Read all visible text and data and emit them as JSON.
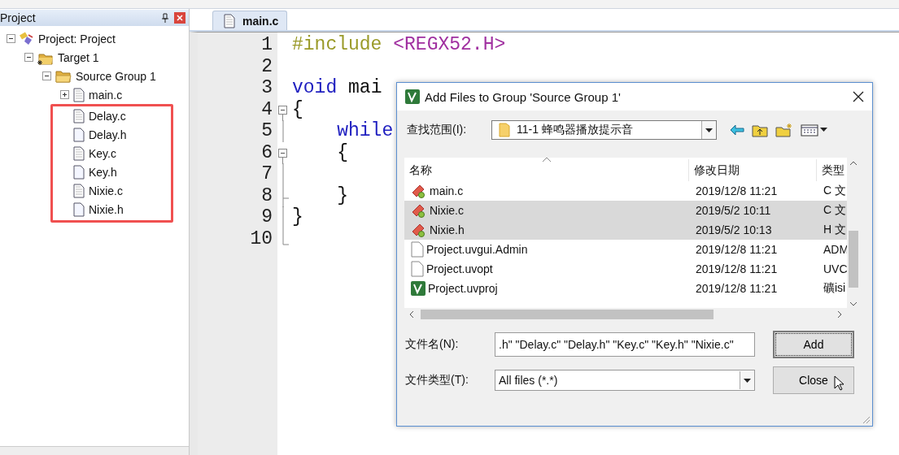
{
  "project_panel": {
    "title": "Project",
    "tree": [
      {
        "label": "Project: Project",
        "kind": "project",
        "expanded": true,
        "children": [
          {
            "label": "Target 1",
            "kind": "target",
            "expanded": true,
            "children": [
              {
                "label": "Source Group 1",
                "kind": "group",
                "expanded": true,
                "children": [
                  {
                    "label": "main.c",
                    "kind": "source",
                    "expanded": false,
                    "highlighted": false
                  },
                  {
                    "label": "Delay.c",
                    "kind": "source",
                    "highlighted": true
                  },
                  {
                    "label": "Delay.h",
                    "kind": "header",
                    "highlighted": true
                  },
                  {
                    "label": "Key.c",
                    "kind": "source",
                    "highlighted": true
                  },
                  {
                    "label": "Key.h",
                    "kind": "header",
                    "highlighted": true
                  },
                  {
                    "label": "Nixie.c",
                    "kind": "source",
                    "highlighted": true
                  },
                  {
                    "label": "Nixie.h",
                    "kind": "header",
                    "highlighted": true
                  }
                ]
              }
            ]
          }
        ]
      }
    ]
  },
  "editor": {
    "tabs": [
      {
        "label": "main.c",
        "selected": true
      }
    ],
    "lines": [
      {
        "number": "1",
        "kind": "plain",
        "segments": [
          {
            "text": "#include",
            "kind": "directive"
          },
          {
            "text": " <REGX52.H>",
            "kind": "header"
          }
        ]
      },
      {
        "number": "2",
        "kind": "plain"
      },
      {
        "number": "3",
        "kind": "plain",
        "segments": [
          {
            "text": "void",
            "kind": "keyword"
          },
          {
            "text": " mai",
            "kind": "plain"
          }
        ]
      },
      {
        "number": "4",
        "kind": "foldstart",
        "segments": [
          {
            "text": "{",
            "kind": "plain"
          }
        ]
      },
      {
        "number": "5",
        "kind": "foldline",
        "segments": [
          {
            "text": "    while",
            "kind": "keyword"
          }
        ]
      },
      {
        "number": "6",
        "kind": "foldstart",
        "segments": [
          {
            "text": "    {",
            "kind": "plain"
          }
        ]
      },
      {
        "number": "7",
        "kind": "foldline"
      },
      {
        "number": "8",
        "kind": "foldtick",
        "segments": [
          {
            "text": "    }",
            "kind": "plain"
          }
        ]
      },
      {
        "number": "9",
        "kind": "foldline",
        "segments": [
          {
            "text": "}",
            "kind": "plain"
          }
        ]
      },
      {
        "number": "10",
        "kind": "foldend"
      }
    ]
  },
  "dialog": {
    "title": "Add Files to Group 'Source Group 1'",
    "look_in": {
      "label": "查找范围(I):",
      "value": "11-1 蜂鸣器播放提示音"
    },
    "columns": [
      {
        "label": "名称",
        "sorted": true
      },
      {
        "label": "修改日期",
        "sorted": false
      },
      {
        "label": "类型",
        "sorted": false
      }
    ],
    "files": [
      {
        "name": "main.c",
        "date": "2019/12/8 11:21",
        "type": "C 文",
        "kind": "source",
        "selected": false
      },
      {
        "name": "Nixie.c",
        "date": "2019/5/2 10:11",
        "type": "C 文",
        "kind": "source",
        "selected": true
      },
      {
        "name": "Nixie.h",
        "date": "2019/5/2 10:13",
        "type": "H 文",
        "kind": "source",
        "selected": true
      },
      {
        "name": "Project.uvgui.Admin",
        "date": "2019/12/8 11:21",
        "type": "ADM",
        "kind": "file",
        "selected": false
      },
      {
        "name": "Project.uvopt",
        "date": "2019/12/8 11:21",
        "type": "UVC",
        "kind": "file",
        "selected": false
      },
      {
        "name": "Project.uvproj",
        "date": "2019/12/8 11:21",
        "type": "礦isi",
        "kind": "project",
        "selected": false
      }
    ],
    "file_name": {
      "label": "文件名(N):",
      "value": ".h\" \"Delay.c\" \"Delay.h\" \"Key.c\" \"Key.h\" \"Nixie.c\""
    },
    "file_type": {
      "label": "文件类型(T):",
      "value": "All files (*.*)"
    },
    "buttons": [
      {
        "label": "Add",
        "focused": true,
        "hovered": false
      },
      {
        "label": "Close",
        "focused": false,
        "hovered": true
      }
    ]
  }
}
